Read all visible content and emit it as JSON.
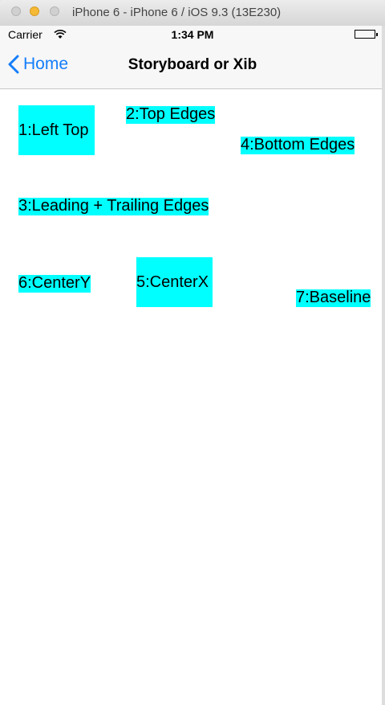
{
  "window": {
    "title": "iPhone 6 - iPhone 6 / iOS 9.3 (13E230)"
  },
  "status_bar": {
    "carrier": "Carrier",
    "time": "1:34 PM"
  },
  "nav": {
    "back_label": "Home",
    "title": "Storyboard or Xib"
  },
  "labels": {
    "left_top": "1:Left Top",
    "top_edges": "2:Top Edges",
    "leading_trailing": "3:Leading + Trailing Edges",
    "bottom_edges": "4:Bottom Edges",
    "center_x": "5:CenterX",
    "center_y": "6:CenterY",
    "baseline": "7:Baseline"
  },
  "colors": {
    "label_background": "#00ffff",
    "accent": "#147efb"
  }
}
